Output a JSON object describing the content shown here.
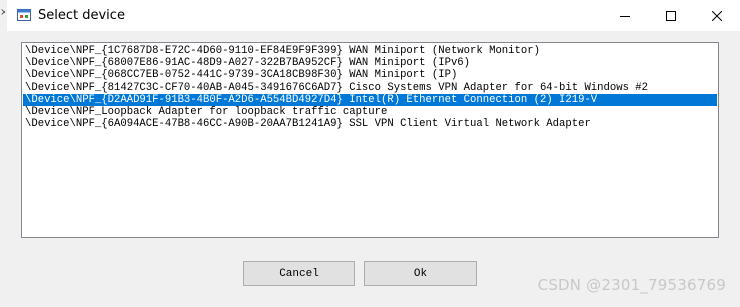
{
  "dialog": {
    "title": "Select device",
    "devices": [
      "\\Device\\NPF_{1C7687D8-E72C-4D60-9110-EF84E9F9F399} WAN Miniport (Network Monitor)",
      "\\Device\\NPF_{68007E86-91AC-48D9-A027-322B7BA952CF} WAN Miniport (IPv6)",
      "\\Device\\NPF_{068CC7EB-0752-441C-9739-3CA18CB98F30} WAN Miniport (IP)",
      "\\Device\\NPF_{81427C3C-CF70-40AB-A045-3491676C6AD7} Cisco Systems VPN Adapter for 64-bit Windows #2",
      "\\Device\\NPF_{D2AAD91F-91B3-4B0F-A2D6-A554BD4927D4} Intel(R) Ethernet Connection (2) I219-V",
      "\\Device\\NPF_Loopback Adapter for loopback traffic capture",
      "\\Device\\NPF_{6A094ACE-47B8-46CC-A90B-20AA7B1241A9} SSL VPN Client Virtual Network Adapter"
    ],
    "selected_index": 4,
    "cancel_label": "Cancel",
    "ok_label": "Ok"
  },
  "watermark": "CSDN @2301_79536769",
  "colors": {
    "selection": "#0078d7",
    "dialog_background": "#f0f0f0"
  },
  "icons": [
    "app-icon",
    "minimize-icon",
    "maximize-icon",
    "close-icon"
  ]
}
